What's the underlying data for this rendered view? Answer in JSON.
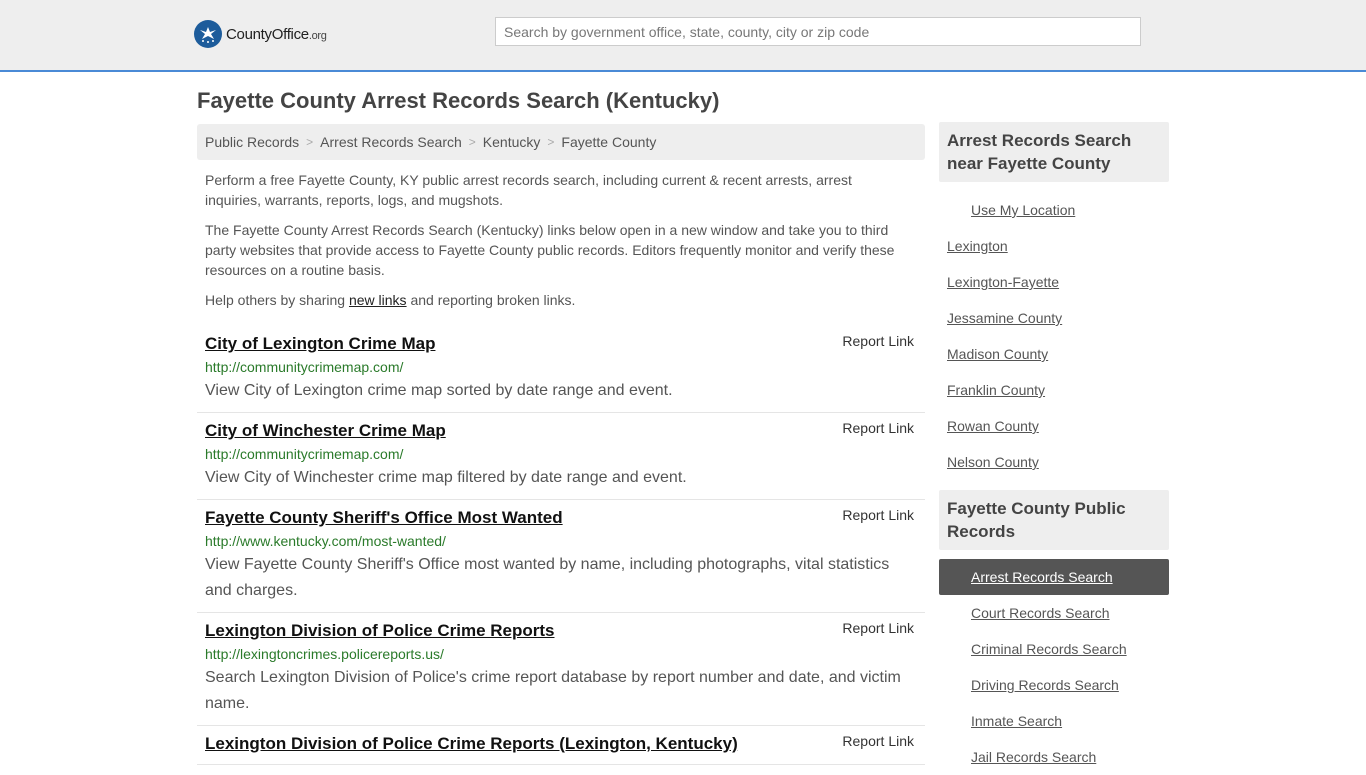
{
  "header": {
    "logo_main": "CountyOffice",
    "logo_tld": ".org",
    "search_placeholder": "Search by government office, state, county, city or zip code"
  },
  "page_title": "Fayette County Arrest Records Search (Kentucky)",
  "breadcrumb": [
    "Public Records",
    "Arrest Records Search",
    "Kentucky",
    "Fayette County"
  ],
  "breadcrumb_sep": ">",
  "intro": {
    "p1": "Perform a free Fayette County, KY public arrest records search, including current & recent arrests, arrest inquiries, warrants, reports, logs, and mugshots.",
    "p2": "The Fayette County Arrest Records Search (Kentucky) links below open in a new window and take you to third party websites that provide access to Fayette County public records. Editors frequently monitor and verify these resources on a routine basis.",
    "p3_before": "Help others by sharing ",
    "p3_link": "new links",
    "p3_after": " and reporting broken links."
  },
  "report_label": "Report Link",
  "results": [
    {
      "title": "City of Lexington Crime Map",
      "url": "http://communitycrimemap.com/",
      "desc": "View City of Lexington crime map sorted by date range and event."
    },
    {
      "title": "City of Winchester Crime Map",
      "url": "http://communitycrimemap.com/",
      "desc": "View City of Winchester crime map filtered by date range and event."
    },
    {
      "title": "Fayette County Sheriff's Office Most Wanted",
      "url": "http://www.kentucky.com/most-wanted/",
      "desc": "View Fayette County Sheriff's Office most wanted by name, including photographs, vital statistics and charges."
    },
    {
      "title": "Lexington Division of Police Crime Reports",
      "url": "http://lexingtoncrimes.policereports.us/",
      "desc": "Search Lexington Division of Police's crime report database by report number and date, and victim name."
    },
    {
      "title": "Lexington Division of Police Crime Reports (Lexington, Kentucky)",
      "url": "",
      "desc": ""
    }
  ],
  "sidebar": {
    "near_title": "Arrest Records Search near Fayette County",
    "use_location": "Use My Location",
    "near_links": [
      "Lexington",
      "Lexington-Fayette",
      "Jessamine County",
      "Madison County",
      "Franklin County",
      "Rowan County",
      "Nelson County"
    ],
    "records_title": "Fayette County Public Records",
    "records_links": [
      "Arrest Records Search",
      "Court Records Search",
      "Criminal Records Search",
      "Driving Records Search",
      "Inmate Search",
      "Jail Records Search"
    ],
    "active_index": 0
  }
}
